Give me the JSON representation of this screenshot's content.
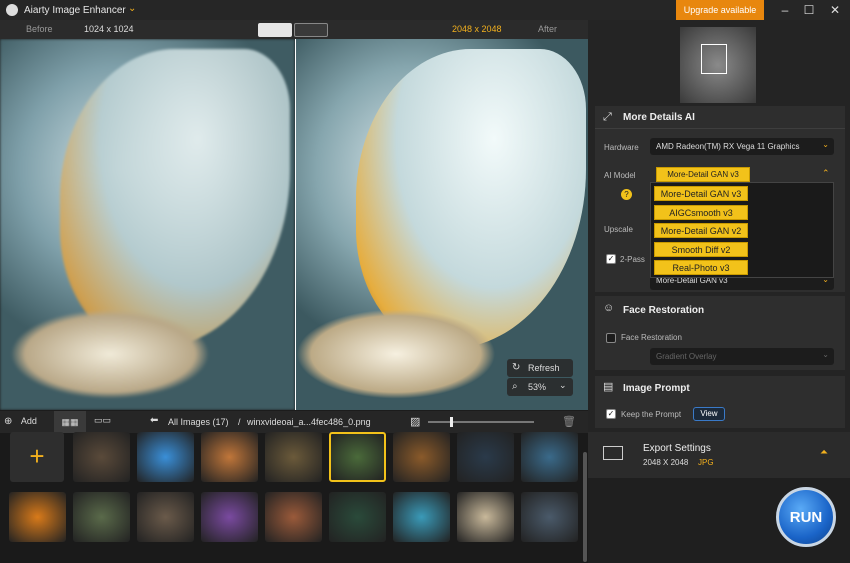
{
  "app": {
    "title": "Aiarty Image Enhancer",
    "upgrade": "Upgrade available"
  },
  "viewer": {
    "before": "Before",
    "before_size": "1024 x 1024",
    "after_size": "2048 x 2048",
    "after": "After",
    "refresh": "Refresh",
    "zoom": "53%"
  },
  "bottombar": {
    "add": "Add",
    "all_images": "All Images (17)",
    "sep": "/",
    "file": "winxvideoai_a...4fec486_0.png"
  },
  "thumbs": {
    "add_symbol": "+",
    "row1": [
      "#5a4a3a",
      "#3a8fd8",
      "#c0763a",
      "#6b5a3a",
      "#4a6a3a",
      "#8a5a2a",
      "#2a3a4a",
      "#3a6a8a"
    ],
    "row2": [
      "#d87a1a",
      "#5a6a4a",
      "#6a5a4a",
      "#7a4aa0",
      "#9a5a3a",
      "#2a4a3a",
      "#3a9ab8",
      "#c8b89a",
      "#4a5a6a"
    ]
  },
  "panel": {
    "details_title": "More Details AI",
    "hardware_label": "Hardware",
    "hardware_value": "AMD Radeon(TM) RX Vega 11 Graphics",
    "model_label": "AI Model",
    "model_value": "More-Detail GAN  v3",
    "models": [
      "More-Detail GAN  v3",
      "AIGCsmooth  v3",
      "More-Detail GAN  v2",
      "Smooth Diff  v2",
      "Real-Photo  v3"
    ],
    "upscale_label": "Upscale",
    "twopass_label": "2-Pass",
    "twopass_model": "More-Detail GAN  v3",
    "face_title": "Face Restoration",
    "face_label": "Face Restoration",
    "face_mode": "Gradient Overlay",
    "prompt_title": "Image Prompt",
    "keep_prompt": "Keep the Prompt",
    "view": "View"
  },
  "export": {
    "title": "Export Settings",
    "size": "2048 X 2048",
    "format": "JPG"
  },
  "run": "RUN"
}
